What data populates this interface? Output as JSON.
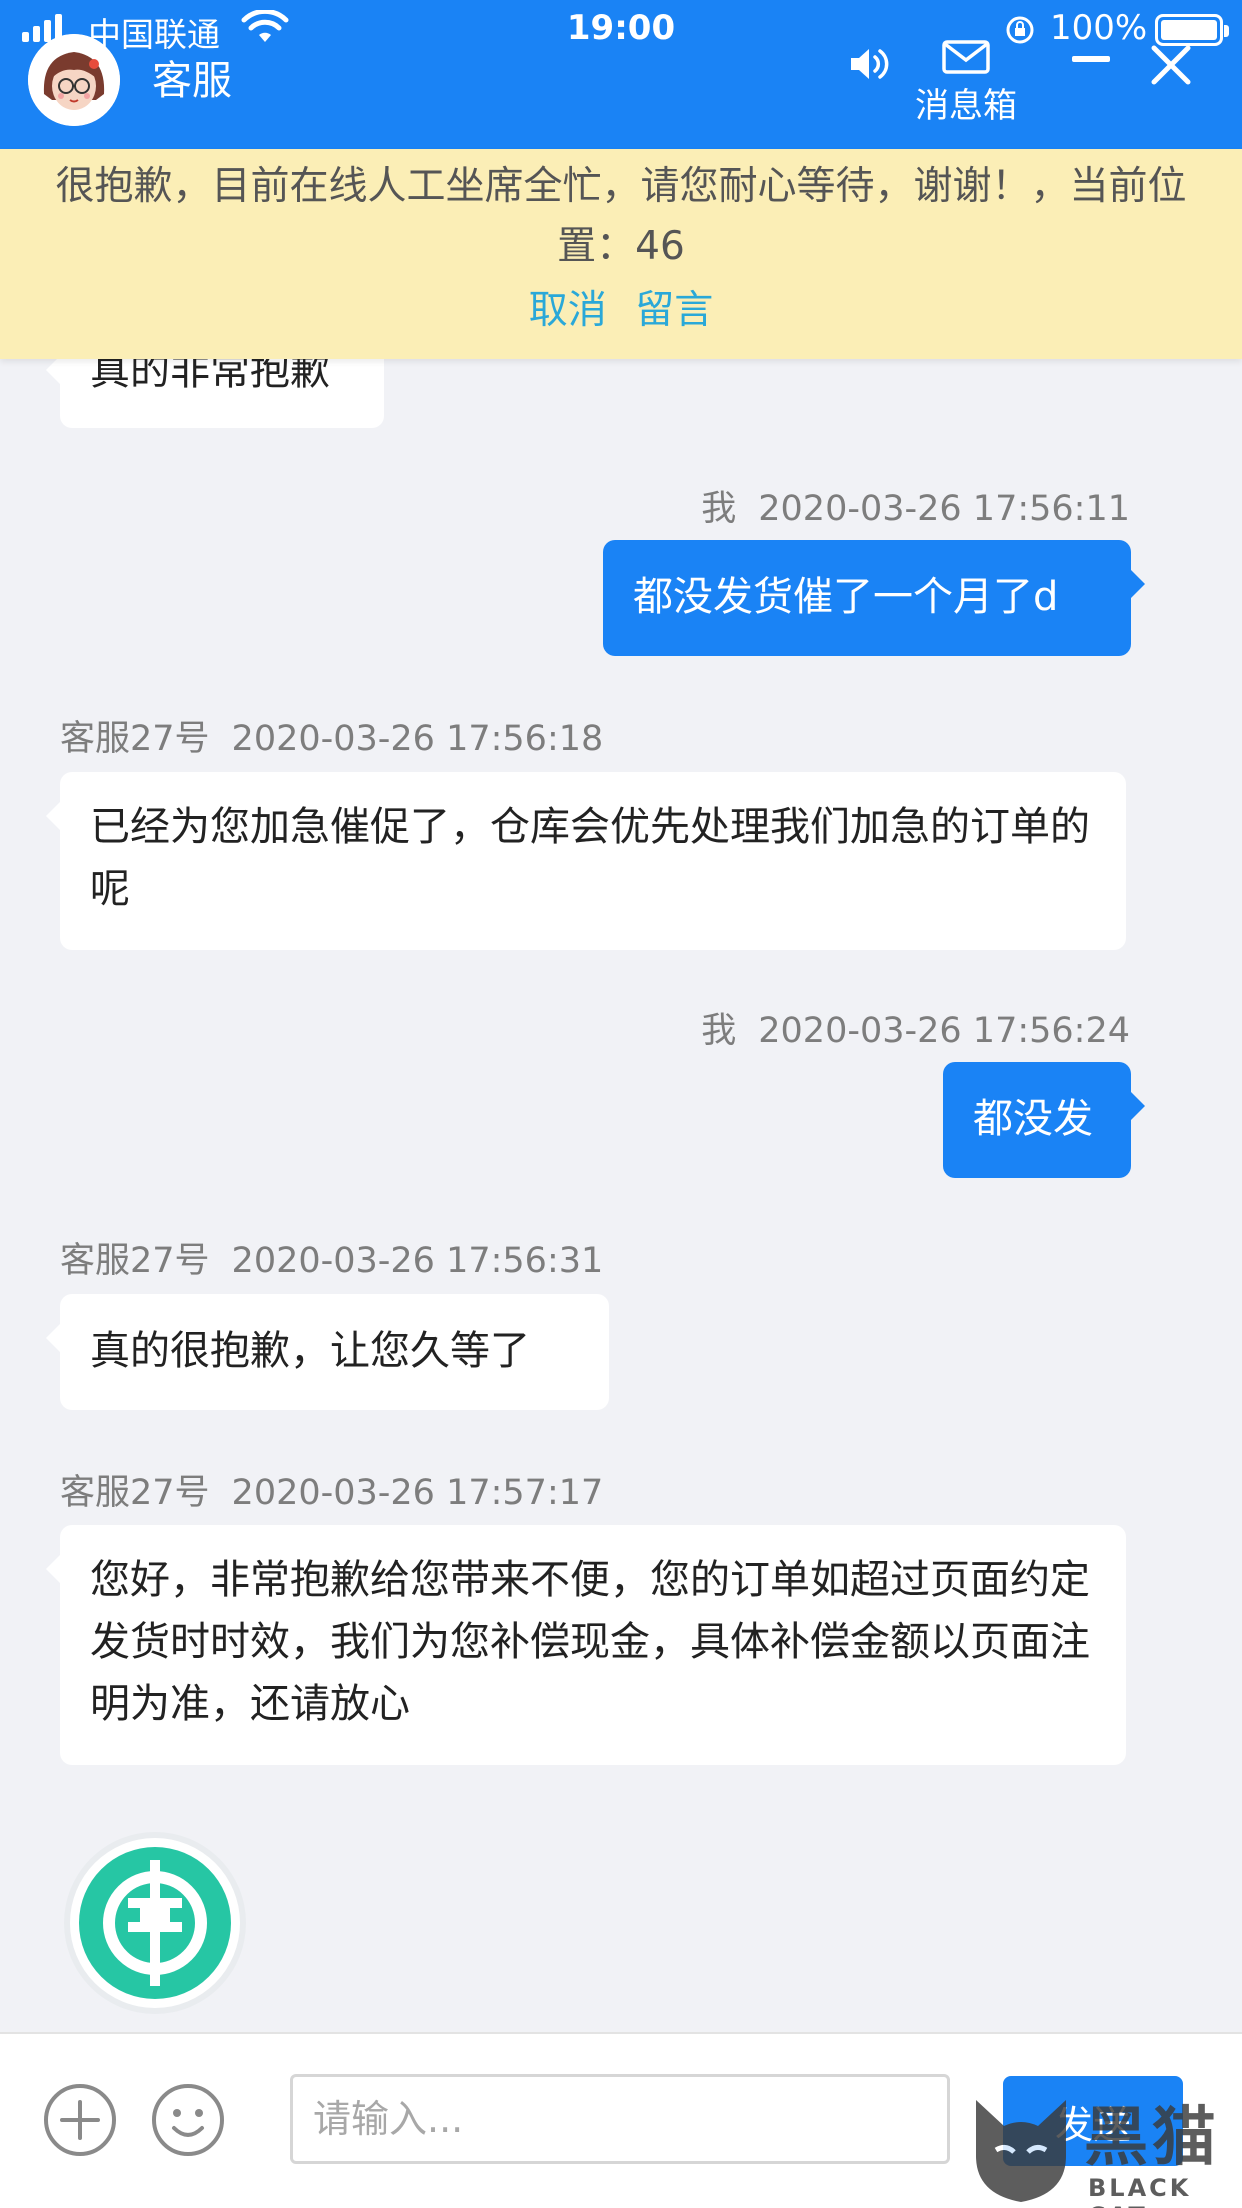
{
  "status_bar": {
    "carrier": "中国联通",
    "time": "19:00",
    "battery": "100%"
  },
  "header": {
    "title": "客服",
    "inbox_label": "消息箱",
    "icons": [
      "avatar",
      "speaker-icon",
      "mail-icon",
      "minimize-icon",
      "close-icon"
    ]
  },
  "notice": {
    "text": "很抱歉，目前在线人工坐席全忙，请您耐心等待，谢谢！，当前位置：46",
    "cancel": "取消",
    "leave_message": "留言"
  },
  "messages": [
    {
      "from": "cs",
      "text": "真的非常抱歉"
    },
    {
      "from": "me",
      "sender": "我",
      "time": "2020-03-26 17:56:11",
      "text": "都没发货催了一个月了d"
    },
    {
      "from": "cs",
      "sender": "客服27号",
      "time": "2020-03-26 17:56:18",
      "text": "已经为您加急催促了，仓库会优先处理我们加急的订单的呢"
    },
    {
      "from": "me",
      "sender": "我",
      "time": "2020-03-26 17:56:24",
      "text": "都没发"
    },
    {
      "from": "cs",
      "sender": "客服27号",
      "time": "2020-03-26 17:56:31",
      "text": "真的很抱歉，让您久等了"
    },
    {
      "from": "cs",
      "sender": "客服27号",
      "time": "2020-03-26 17:57:17",
      "text": "您好，非常抱歉给您带来不便，您的订单如超过页面约定发货时时效，我们为您补偿现金，具体补偿金额以页面注明为准，还请放心"
    }
  ],
  "input_bar": {
    "placeholder": "请输入...",
    "value": "",
    "send_label": "发送"
  },
  "watermark": {
    "cn": "黑猫",
    "en": "BLACK CAT"
  },
  "colors": {
    "brand_blue": "#1a83f5",
    "notice_bg": "#fbeeb6",
    "notice_link": "#2aa8d8",
    "chat_bg": "#f1f2f6",
    "logo_teal": "#26c6a4"
  }
}
